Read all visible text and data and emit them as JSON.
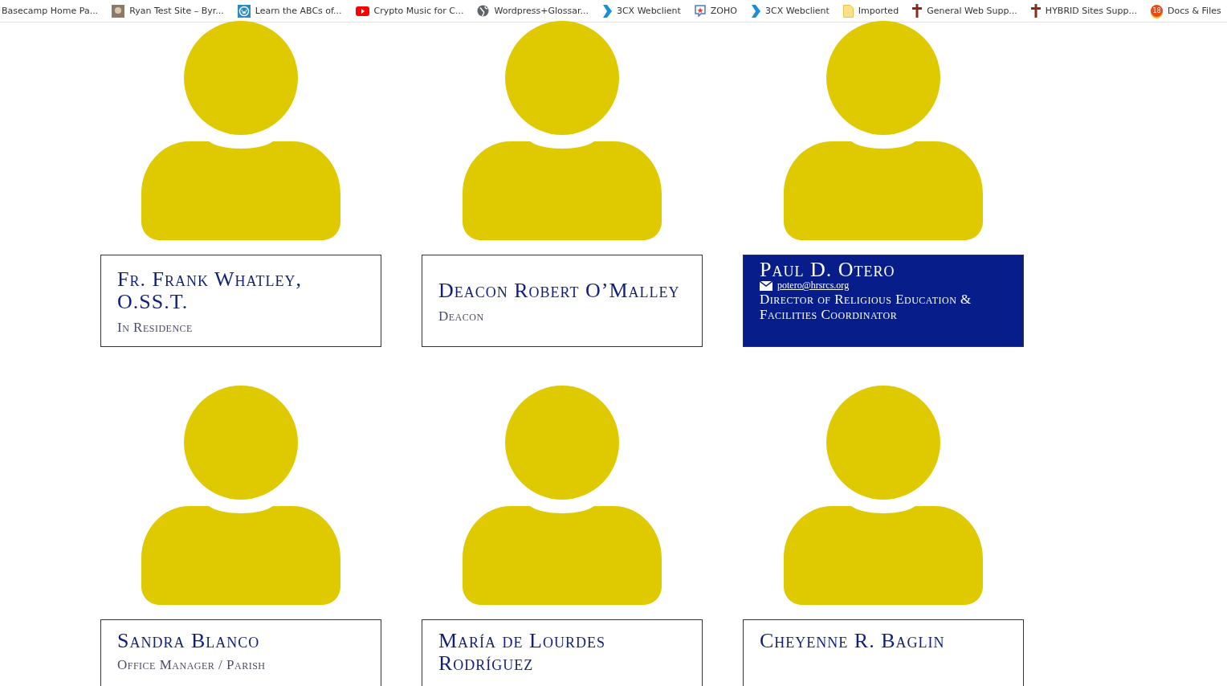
{
  "bookmarks": [
    {
      "label": "Basecamp Home Pa...",
      "kind": "plain"
    },
    {
      "label": "Ryan Test Site – Byr...",
      "kind": "photo"
    },
    {
      "label": "Learn the ABCs of...",
      "kind": "wordpress"
    },
    {
      "label": "Crypto Music for C...",
      "kind": "video"
    },
    {
      "label": "Wordpress+Glossar...",
      "kind": "globe"
    },
    {
      "label": "3CX Webclient",
      "kind": "chevron"
    },
    {
      "label": "ZOHO",
      "kind": "chat"
    },
    {
      "label": "3CX Webclient",
      "kind": "chevron"
    },
    {
      "label": "Imported",
      "kind": "folder"
    },
    {
      "label": "General Web Supp...",
      "kind": "cross"
    },
    {
      "label": "HYBRID Sites Supp...",
      "kind": "cross"
    },
    {
      "label": "Docs & Files",
      "kind": "badge",
      "badge": "18"
    }
  ],
  "staff": [
    {
      "name": "Fr. Frank Whatley, O.SS.T.",
      "role": "In Residence",
      "selected": false
    },
    {
      "name": "Deacon Robert O’Malley",
      "role": "Deacon",
      "selected": false
    },
    {
      "name": "Paul D. Otero",
      "role": "Director of Religious Education & Facilities Coordinator",
      "email": "potero@hrsrcs.org",
      "selected": true
    },
    {
      "name": "Sandra Blanco",
      "role": "Office Manager / Parish",
      "selected": false
    },
    {
      "name": "María de Lourdes Rodríguez",
      "selected": false
    },
    {
      "name": "Cheyenne R. Baglin",
      "selected": false
    }
  ]
}
